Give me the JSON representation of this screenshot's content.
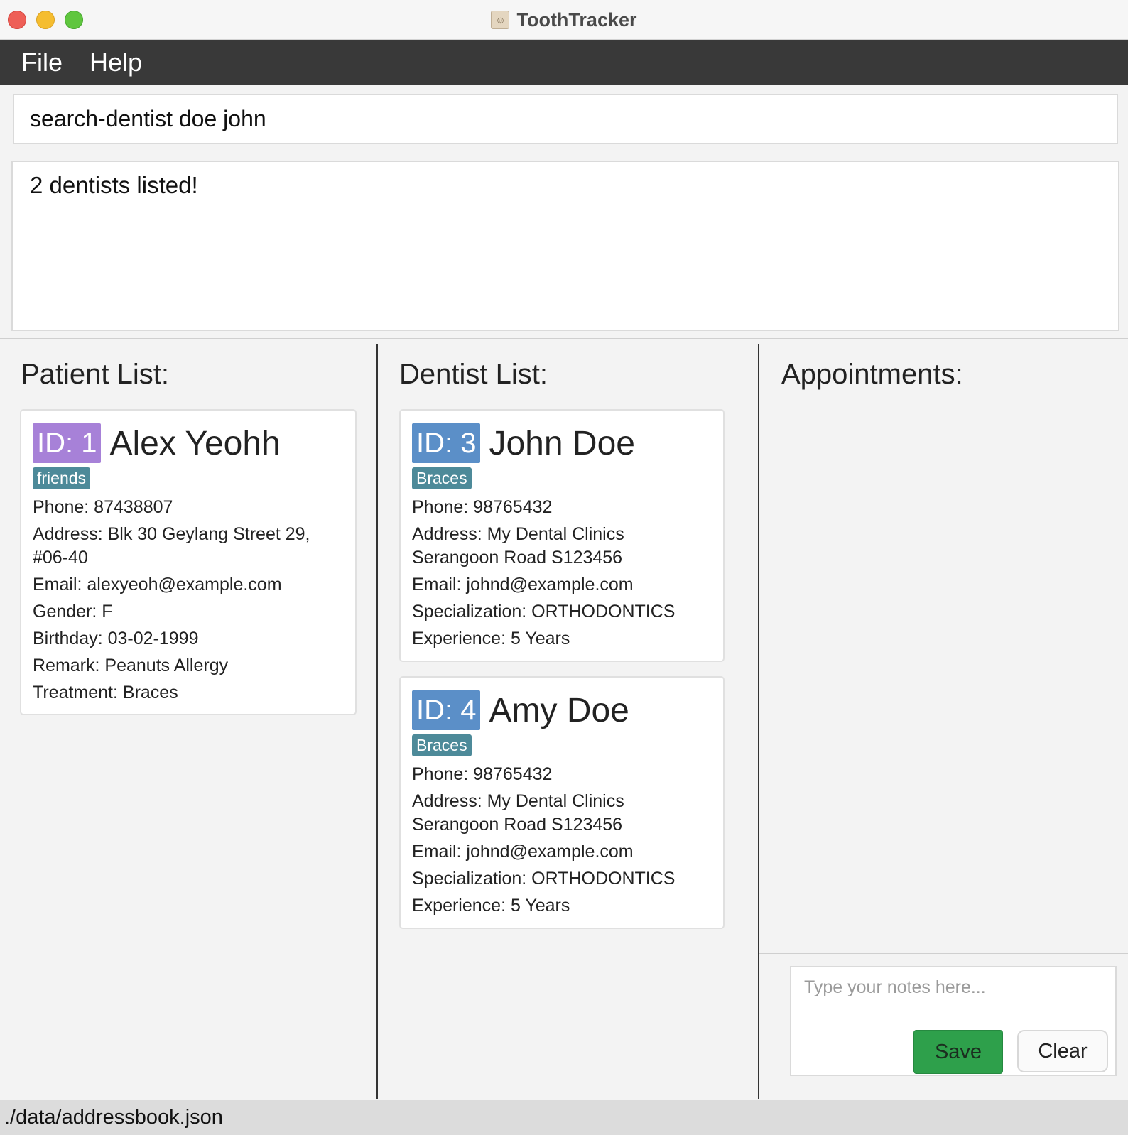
{
  "window": {
    "title": "ToothTracker",
    "icon": "address-book-icon"
  },
  "menu": {
    "items": [
      {
        "label": "File"
      },
      {
        "label": "Help"
      }
    ]
  },
  "command": {
    "value": "search-dentist doe john"
  },
  "result": {
    "message": "2 dentists listed!"
  },
  "patients": {
    "title": "Patient List:",
    "items": [
      {
        "id": "ID: 1",
        "name": "Alex Yeohh",
        "tag": "friends",
        "phone": "Phone: 87438807",
        "address": "Address: Blk 30 Geylang Street 29, #06-40",
        "email": "Email: alexyeoh@example.com",
        "gender": "Gender: F",
        "birthday": "Birthday: 03-02-1999",
        "remark": "Remark: Peanuts Allergy",
        "treatment": "Treatment: Braces"
      }
    ]
  },
  "dentists": {
    "title": "Dentist List:",
    "items": [
      {
        "id": "ID: 3",
        "name": "John Doe",
        "tag": "Braces",
        "phone": "Phone: 98765432",
        "address": "Address: My Dental Clinics Serangoon Road S123456",
        "email": "Email: johnd@example.com",
        "specialization": "Specialization: ORTHODONTICS",
        "experience": "Experience: 5 Years"
      },
      {
        "id": "ID: 4",
        "name": "Amy Doe",
        "tag": "Braces",
        "phone": "Phone: 98765432",
        "address": "Address: My Dental Clinics Serangoon Road S123456",
        "email": "Email: johnd@example.com",
        "specialization": "Specialization: ORTHODONTICS",
        "experience": "Experience: 5 Years"
      }
    ]
  },
  "appointments": {
    "title": "Appointments:"
  },
  "notes": {
    "placeholder": "Type your notes here...",
    "save_label": "Save",
    "clear_label": "Clear"
  },
  "status": {
    "path": "./data/addressbook.json"
  },
  "colors": {
    "patient_id_badge": "#a781d8",
    "dentist_id_badge": "#5b8fc8",
    "tag": "#4d8a99",
    "save_button": "#2ea04b",
    "menubar": "#393939"
  }
}
